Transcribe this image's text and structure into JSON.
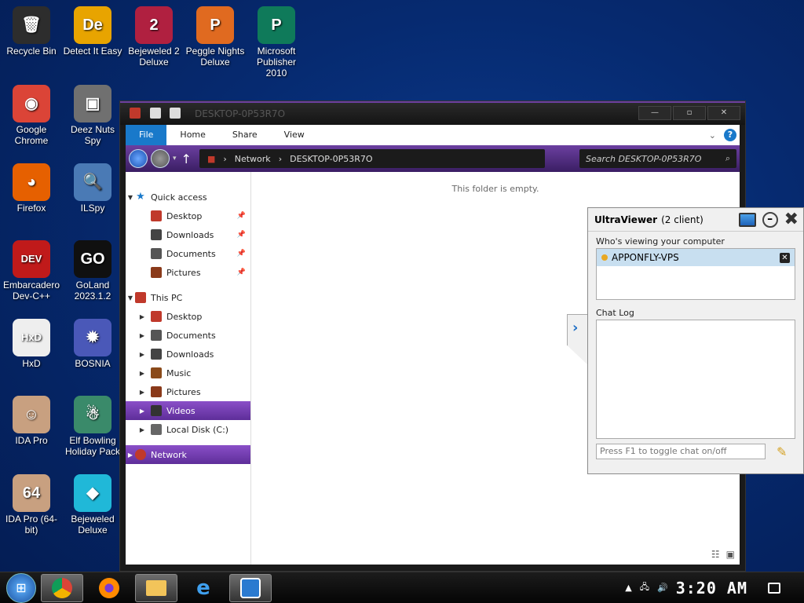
{
  "desktop": {
    "icons": [
      {
        "label": "Recycle Bin",
        "icon": "recycle-bin-icon",
        "color": "#2d2d2d",
        "glyph": "🗑"
      },
      {
        "label": "Detect It Easy",
        "icon": "detect-it-easy-icon",
        "color": "#e8a400",
        "glyph": "De"
      },
      {
        "label": "Bejeweled 2 Deluxe",
        "icon": "bejeweled-2-icon",
        "color": "#b02040",
        "glyph": "2"
      },
      {
        "label": "Peggle Nights Deluxe",
        "icon": "peggle-nights-icon",
        "color": "#e06a20",
        "glyph": "P"
      },
      {
        "label": "Microsoft Publisher 2010",
        "icon": "publisher-icon",
        "color": "#0f7a5a",
        "glyph": "P"
      },
      {
        "label": "Google Chrome",
        "icon": "chrome-icon",
        "color": "#db4437",
        "glyph": "◉"
      },
      {
        "label": "Deez Nuts Spy",
        "icon": "deez-nuts-spy-icon",
        "color": "#707070",
        "glyph": "▣"
      },
      {
        "label": "Firefox",
        "icon": "firefox-icon",
        "color": "#e66000",
        "glyph": "◕"
      },
      {
        "label": "ILSpy",
        "icon": "ilspy-icon",
        "color": "#4a7ab5",
        "glyph": "🔍"
      },
      {
        "label": "Embarcadero Dev-C++",
        "icon": "devcpp-icon",
        "color": "#c01a1a",
        "glyph": "DEV"
      },
      {
        "label": "GoLand 2023.1.2",
        "icon": "goland-icon",
        "color": "#101010",
        "glyph": "GO"
      },
      {
        "label": "HxD",
        "icon": "hxd-icon",
        "color": "#eeeeee",
        "glyph": "HxD"
      },
      {
        "label": "BOSNIA",
        "icon": "bosnia-icon",
        "color": "#4a58b8",
        "glyph": "✹"
      },
      {
        "label": "IDA Pro",
        "icon": "ida-pro-icon",
        "color": "#c8a080",
        "glyph": "☺"
      },
      {
        "label": "Elf Bowling Holiday Pack",
        "icon": "elf-bowling-icon",
        "color": "#3a8a6a",
        "glyph": "☃"
      },
      {
        "label": "IDA Pro (64-bit)",
        "icon": "ida-pro-64-icon",
        "color": "#c8a080",
        "glyph": "64"
      },
      {
        "label": "Bejeweled Deluxe",
        "icon": "bejeweled-deluxe-icon",
        "color": "#20b8d8",
        "glyph": "◆"
      }
    ]
  },
  "explorer": {
    "title": "DESKTOP-0P53R7O",
    "ribbon_tabs": [
      "File",
      "Home",
      "Share",
      "View"
    ],
    "address": {
      "part1": "Network",
      "part2": "DESKTOP-0P53R7O"
    },
    "search_placeholder": "Search DESKTOP-0P53R7O",
    "empty_message": "This folder is empty.",
    "nav": {
      "quick_access": "Quick access",
      "quick_items": [
        "Desktop",
        "Downloads",
        "Documents",
        "Pictures"
      ],
      "this_pc": "This PC",
      "pc_items": [
        "Desktop",
        "Documents",
        "Downloads",
        "Music",
        "Pictures",
        "Videos",
        "Local Disk (C:)"
      ],
      "network": "Network"
    }
  },
  "ultraviewer": {
    "title": "UltraViewer",
    "clients": "(2 client)",
    "viewing_label": "Who's viewing your computer",
    "client_name": "APPONFLY-VPS",
    "chat_label": "Chat Log",
    "chat_placeholder": "Press F1 to toggle chat on/off"
  },
  "taskbar": {
    "clock": "3:20 AM"
  }
}
